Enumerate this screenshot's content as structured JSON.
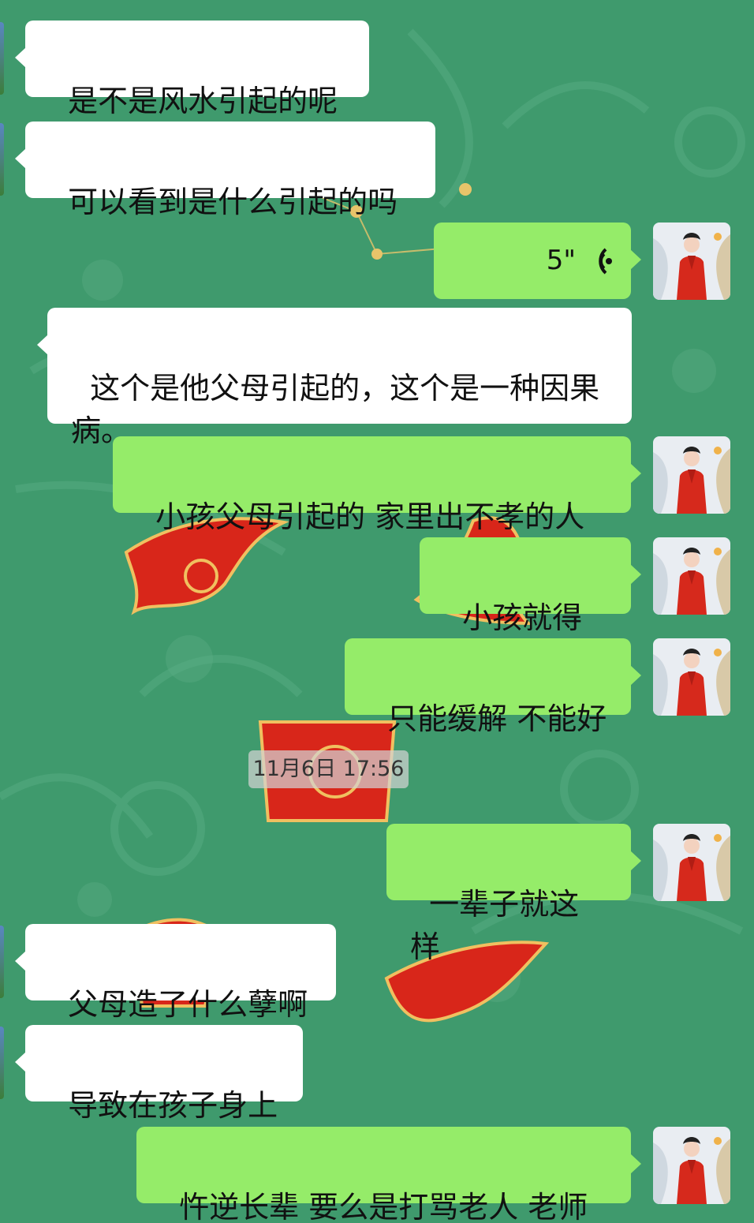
{
  "chat": {
    "messages": [
      {
        "side": "left",
        "text": "是不是风水引起的呢"
      },
      {
        "side": "left",
        "text": "可以看到是什么引起的吗"
      },
      {
        "side": "right",
        "type": "voice",
        "text": "5\""
      },
      {
        "side": "left",
        "text": "这个是他父母引起的，这个是一种因果病。"
      },
      {
        "side": "right",
        "text": "小孩父母引起的 家里出不孝的人"
      },
      {
        "side": "right",
        "text": "小孩就得病"
      },
      {
        "side": "right",
        "text": "只能缓解 不能好"
      },
      {
        "side": "right",
        "text": "一辈子就这样"
      },
      {
        "side": "left",
        "text": "父母造了什么孽啊"
      },
      {
        "side": "left",
        "text": "导致在孩子身上"
      },
      {
        "side": "right",
        "text": "忤逆长辈 要么是打骂老人 老师"
      }
    ],
    "timestamp": "11月6日 17:56"
  },
  "colors": {
    "background": "#3f9a6d",
    "bubble_self": "#95ec69",
    "bubble_other": "#ffffff",
    "decor_red": "#d8261a"
  },
  "icons": {
    "voice": "voice-wave-icon",
    "avatar": "user-avatar-icon"
  }
}
